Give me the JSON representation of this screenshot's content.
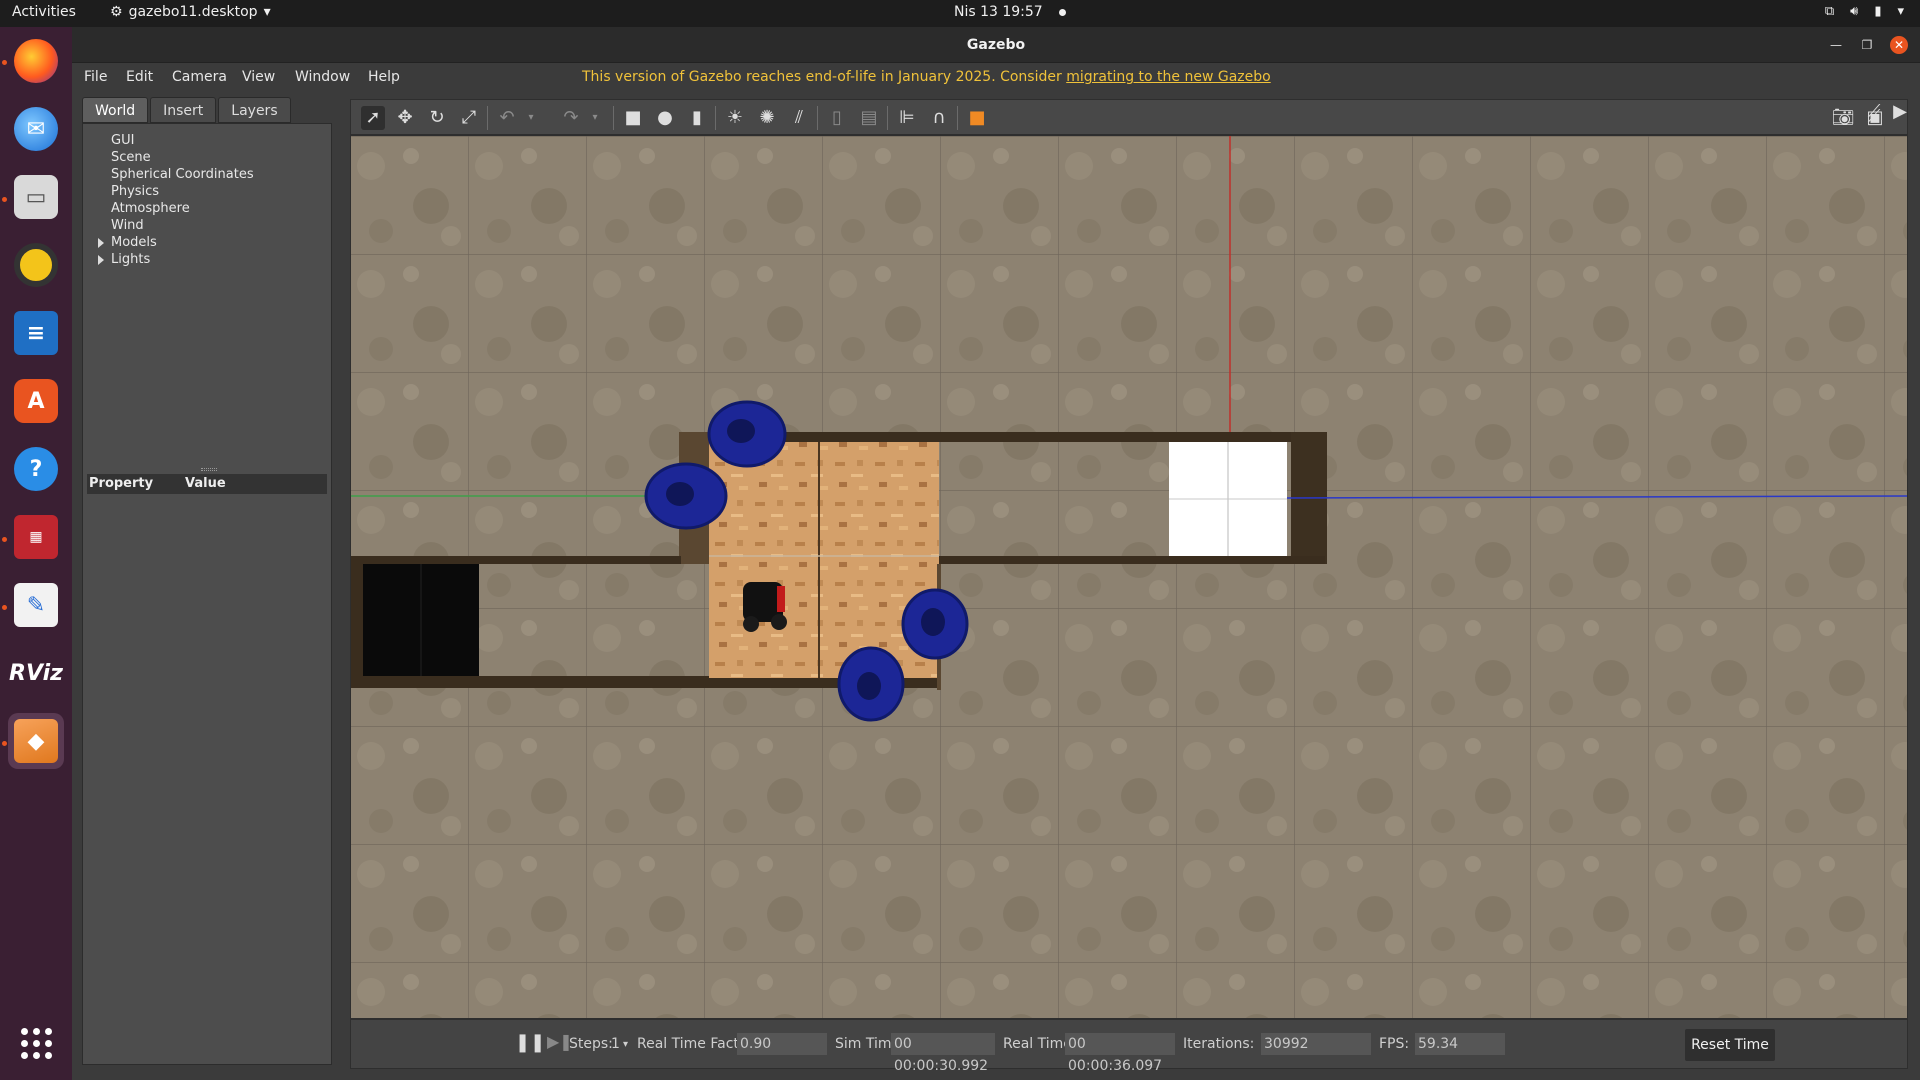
{
  "topbar": {
    "activities": "Activities",
    "app_menu": "gazebo11.desktop",
    "clock": "Nis 13  19:57"
  },
  "dock": {
    "items": [
      {
        "name": "firefox",
        "icon": "firefox-icon"
      },
      {
        "name": "thunderbird",
        "icon": "thunderbird-icon"
      },
      {
        "name": "files",
        "icon": "files-icon"
      },
      {
        "name": "rhythmbox",
        "icon": "rhythmbox-icon"
      },
      {
        "name": "writer",
        "icon": "writer-icon"
      },
      {
        "name": "app-center",
        "icon": "app-center-icon"
      },
      {
        "name": "help",
        "icon": "help-icon"
      },
      {
        "name": "terminal-tiles",
        "icon": "tiles-icon"
      },
      {
        "name": "text-editor",
        "icon": "text-editor-icon"
      },
      {
        "name": "rviz",
        "label": "RViz",
        "icon": "rviz-icon"
      },
      {
        "name": "gazebo",
        "icon": "gazebo-icon"
      }
    ],
    "show_apps_icon": "app-grid-icon"
  },
  "window": {
    "title": "Gazebo"
  },
  "menubar": {
    "items": [
      "File",
      "Edit",
      "Camera",
      "View",
      "Window",
      "Help"
    ],
    "notice": "This version of Gazebo reaches end-of-life in January 2025. Consider ",
    "notice_link": "migrating to the new Gazebo"
  },
  "left_panel": {
    "tabs": [
      "World",
      "Insert",
      "Layers"
    ],
    "active_tab": "World",
    "tree": [
      {
        "label": "GUI",
        "expandable": false
      },
      {
        "label": "Scene",
        "expandable": false
      },
      {
        "label": "Spherical Coordinates",
        "expandable": false
      },
      {
        "label": "Physics",
        "expandable": false
      },
      {
        "label": "Atmosphere",
        "expandable": false
      },
      {
        "label": "Wind",
        "expandable": false
      },
      {
        "label": "Models",
        "expandable": true
      },
      {
        "label": "Lights",
        "expandable": true
      }
    ],
    "property_header": "Property",
    "value_header": "Value"
  },
  "bottom_bar": {
    "steps_label": "Steps:",
    "steps_value": "1",
    "rtf_label": "Real Time Factor:",
    "rtf_value": "0.90",
    "sim_time_label": "Sim Time:",
    "sim_time_value": "00 00:00:30.992",
    "real_time_label": "Real Time:",
    "real_time_value": "00 00:00:36.097",
    "iterations_label": "Iterations:",
    "iterations_value": "30992",
    "fps_label": "FPS:",
    "fps_value": "59.34",
    "reset_label": "Reset Time"
  },
  "colors": {
    "accent": "#e95420",
    "notice": "#f0c23a",
    "wheel_blue": "#1f2a9c",
    "ground": "#8b8070"
  }
}
